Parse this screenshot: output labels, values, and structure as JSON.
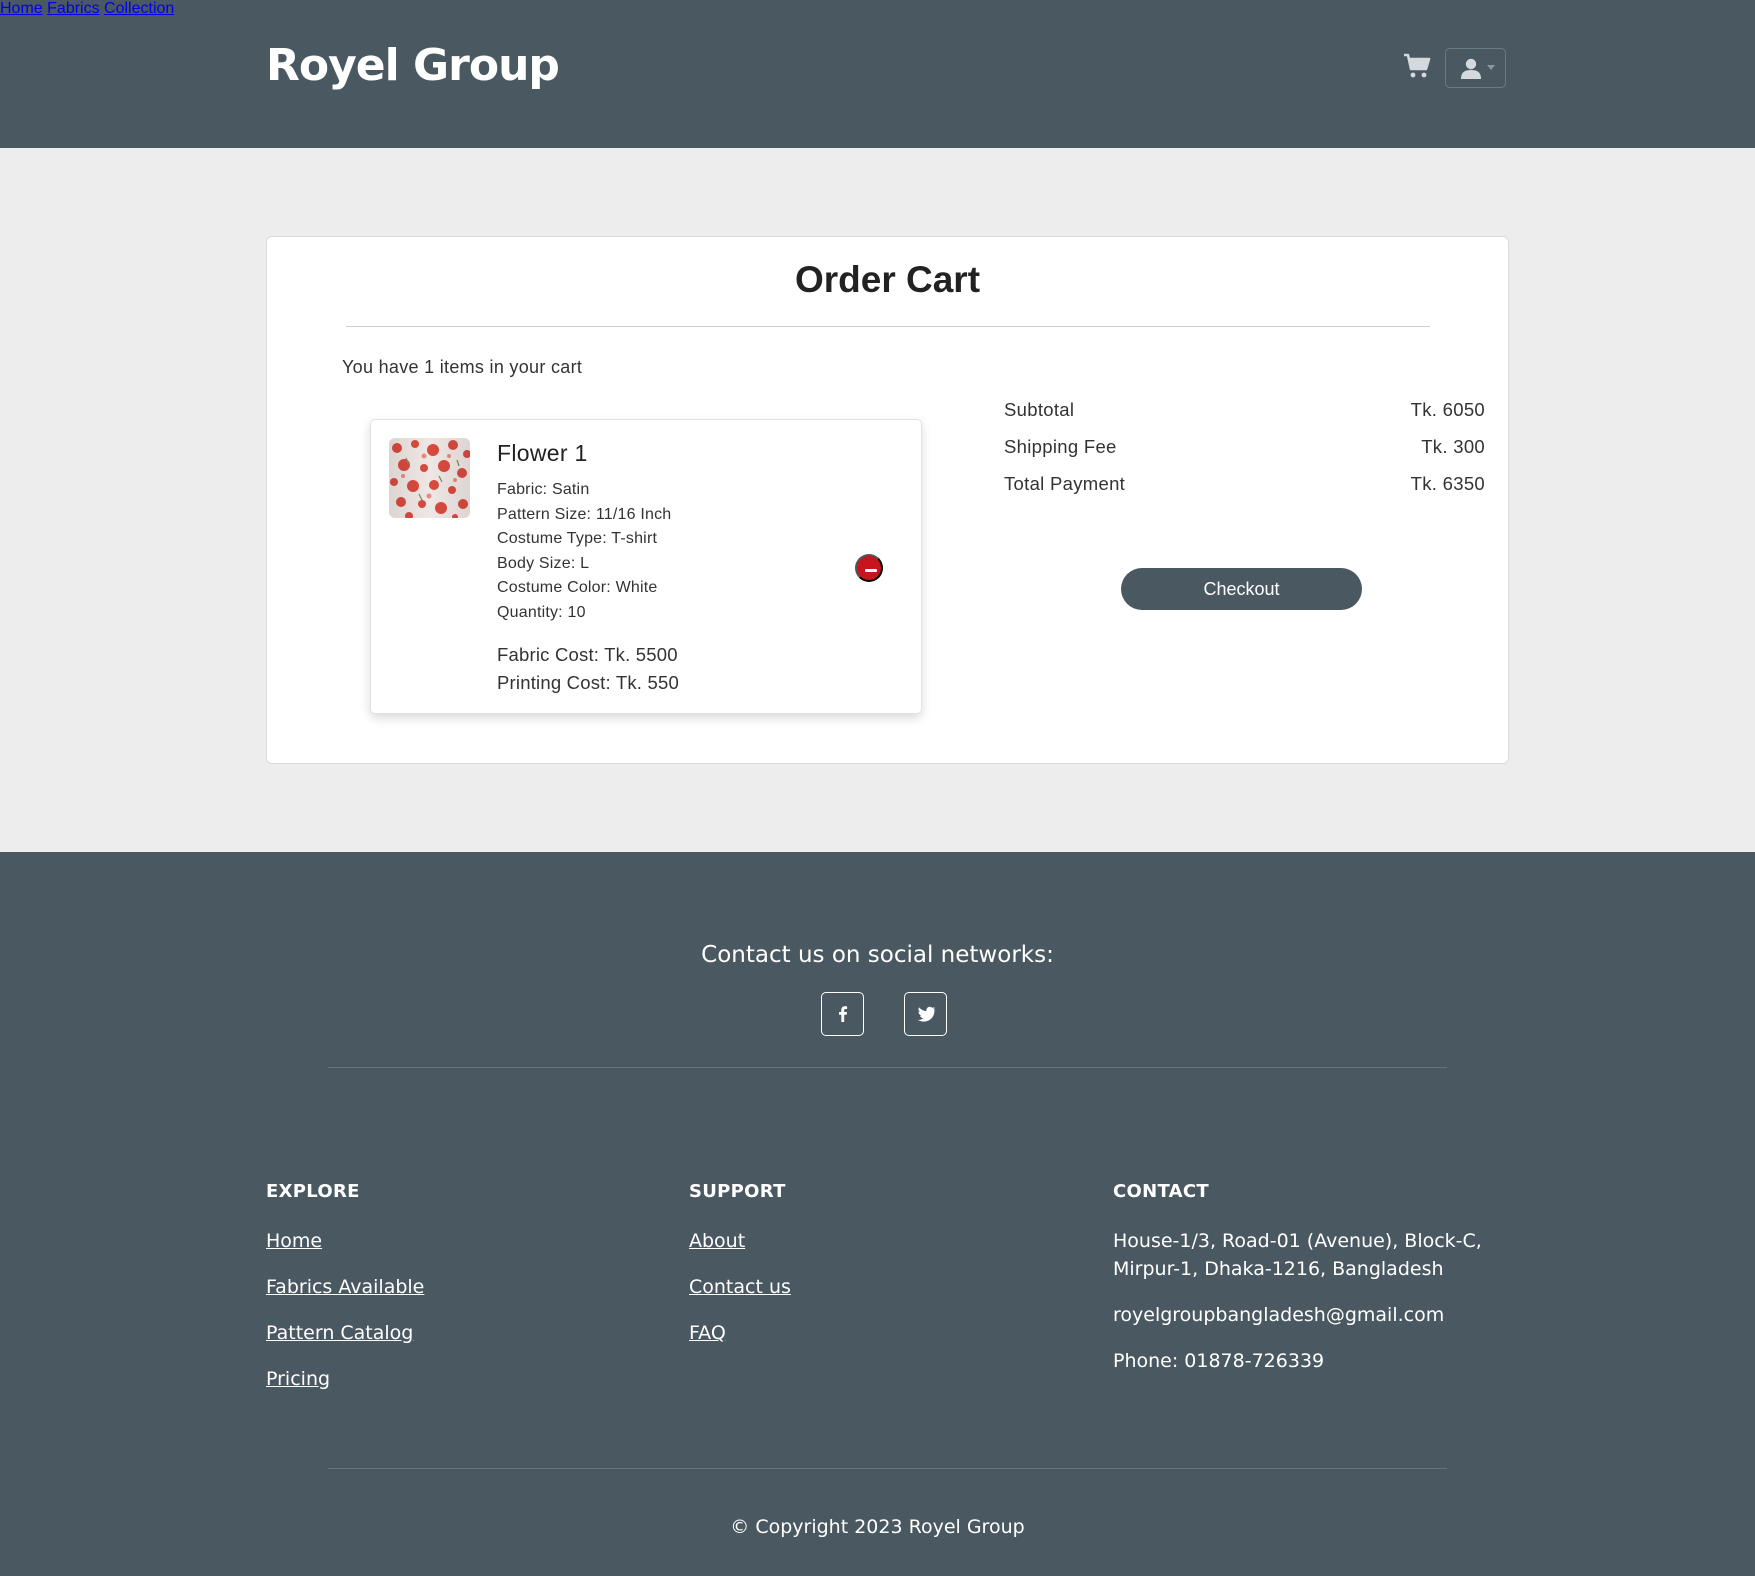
{
  "header": {
    "brand": "Royel Group",
    "nav": [
      "Home",
      "Fabrics",
      "Collection"
    ],
    "cart_icon": "shopping-cart-icon",
    "user_icon": "user-icon"
  },
  "cart": {
    "title": "Order Cart",
    "items_count_text": "You have 1 items in your cart",
    "items": [
      {
        "name": "Flower 1",
        "attributes": [
          "Fabric: Satin",
          "Pattern Size: 11/16 Inch",
          "Costume Type: T-shirt",
          "Body Size: L",
          "Costume Color: White",
          "Quantity: 10"
        ],
        "fabric_cost": "Fabric Cost: Tk. 5500",
        "printing_cost": "Printing Cost: Tk. 550",
        "remove_icon": "minus-circle-icon"
      }
    ],
    "summary": [
      {
        "label": "Subtotal",
        "value": "Tk. 6050"
      },
      {
        "label": "Shipping Fee",
        "value": "Tk. 300"
      },
      {
        "label": "Total Payment",
        "value": "Tk. 6350"
      }
    ],
    "checkout_label": "Checkout"
  },
  "footer": {
    "social_title": "Contact us on social networks:",
    "social_icons": [
      "facebook-icon",
      "twitter-icon"
    ],
    "explore": {
      "title": "EXPLORE",
      "links": [
        "Home",
        "Fabrics Available",
        "Pattern Catalog",
        "Pricing"
      ]
    },
    "support": {
      "title": "SUPPORT",
      "links": [
        "About",
        "Contact us",
        "FAQ"
      ]
    },
    "contact": {
      "title": "CONTACT",
      "address_line1": "House-1/3, Road-01 (Avenue), Block-C,",
      "address_line2": "Mirpur-1, Dhaka-1216, Bangladesh",
      "email": "royelgroupbangladesh@gmail.com",
      "phone": "Phone: 01878-726339"
    },
    "copyright": "© Copyright 2023 Royel Group"
  },
  "colors": {
    "header_bg": "#4a5862",
    "page_bg": "#ededed",
    "remove_red": "#c8141f"
  }
}
